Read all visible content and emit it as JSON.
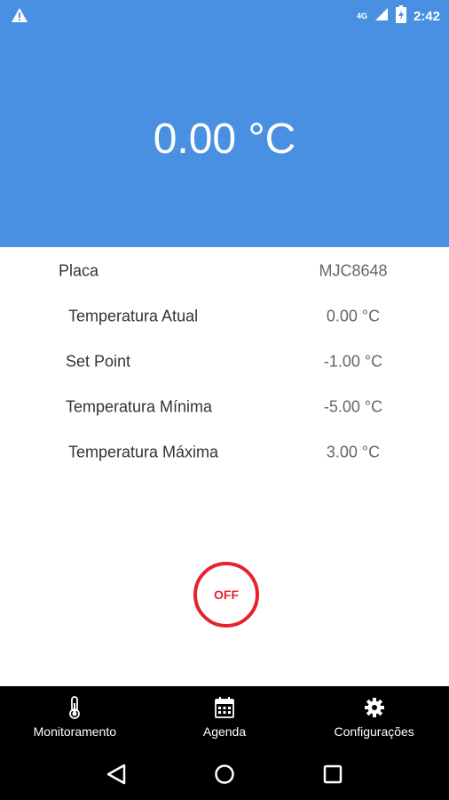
{
  "status_bar": {
    "network_label": "4G",
    "time": "2:42",
    "icons": [
      "warning-icon",
      "signal-icon",
      "battery-icon"
    ]
  },
  "header": {
    "current_temperature": "0.00 °C",
    "background_color": "#4a90e2"
  },
  "info_rows": [
    {
      "label": "Placa",
      "value": "MJC8648"
    },
    {
      "label": "Temperatura Atual",
      "value": "0.00 °C"
    },
    {
      "label": "Set Point",
      "value": "-1.00 °C"
    },
    {
      "label": "Temperatura Mínima",
      "value": "-5.00 °C"
    },
    {
      "label": "Temperatura Máxima",
      "value": "3.00 °C"
    }
  ],
  "power_button": {
    "label": "OFF",
    "color": "#e8212e"
  },
  "bottom_nav": {
    "items": [
      {
        "label": "Monitoramento",
        "icon": "thermometer-icon"
      },
      {
        "label": "Agenda",
        "icon": "calendar-icon"
      },
      {
        "label": "Configurações",
        "icon": "gear-icon"
      }
    ]
  },
  "system_nav": {
    "icons": [
      "back-icon",
      "home-icon",
      "recents-icon"
    ]
  }
}
